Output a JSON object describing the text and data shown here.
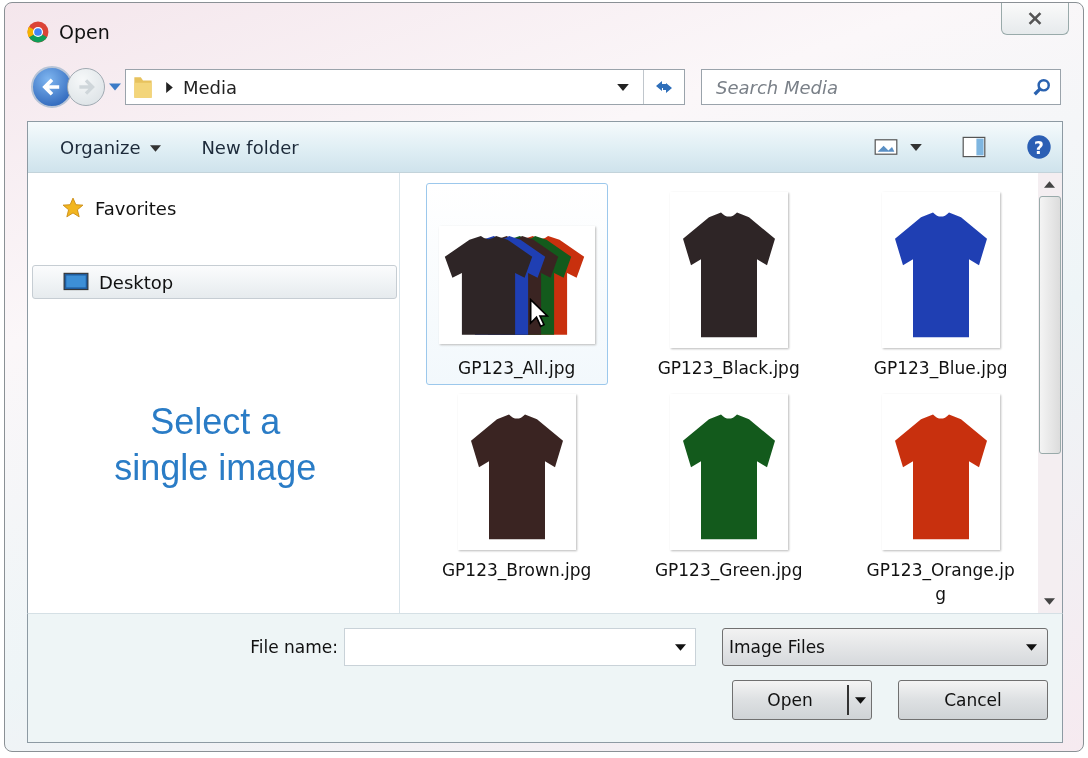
{
  "window": {
    "title": "Open"
  },
  "address": {
    "path": "Media",
    "search_placeholder": "Search Media"
  },
  "toolbar": {
    "organize": "Organize",
    "new_folder": "New folder",
    "help": "?"
  },
  "sidebar": {
    "items": [
      {
        "label": "Favorites",
        "kind": "favorites",
        "selected": false
      },
      {
        "label": "Desktop",
        "kind": "desktop",
        "selected": true
      }
    ],
    "hint": "Select a single image"
  },
  "files": [
    {
      "name": "GP123_All.jpg",
      "kind": "set",
      "selected": true
    },
    {
      "name": "GP123_Black.jpg",
      "kind": "single",
      "color": "#2e2526",
      "selected": false
    },
    {
      "name": "GP123_Blue.jpg",
      "kind": "single",
      "color": "#1f3fb3",
      "selected": false
    },
    {
      "name": "GP123_Brown.jpg",
      "kind": "single",
      "color": "#3a2422",
      "selected": false
    },
    {
      "name": "GP123_Green.jpg",
      "kind": "single",
      "color": "#135a1c",
      "selected": false
    },
    {
      "name": "GP123_Orange.jpg",
      "kind": "single",
      "color": "#c8300e",
      "selected": false
    }
  ],
  "footer": {
    "file_name_label": "File name:",
    "file_type": "Image Files",
    "open": "Open",
    "cancel": "Cancel"
  }
}
